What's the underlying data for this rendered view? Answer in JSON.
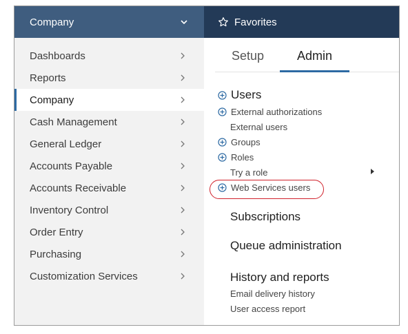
{
  "left_header": {
    "title": "Company",
    "icon": "chevron-down-icon"
  },
  "right_header": {
    "title": "Favorites",
    "icon": "star-outline-icon"
  },
  "nav": {
    "items": [
      {
        "label": "Dashboards"
      },
      {
        "label": "Reports"
      },
      {
        "label": "Company",
        "active": true
      },
      {
        "label": "Cash Management"
      },
      {
        "label": "General Ledger"
      },
      {
        "label": "Accounts Payable"
      },
      {
        "label": "Accounts Receivable"
      },
      {
        "label": "Inventory Control"
      },
      {
        "label": "Order Entry"
      },
      {
        "label": "Purchasing"
      },
      {
        "label": "Customization Services"
      }
    ]
  },
  "tabs": {
    "setup": "Setup",
    "admin": "Admin",
    "active": "Admin"
  },
  "admin": {
    "users_heading": "Users",
    "external_authorizations": "External authorizations",
    "external_users": "External users",
    "groups": "Groups",
    "roles": "Roles",
    "try_a_role": "Try a role",
    "web_services_users": "Web Services users",
    "subscriptions": "Subscriptions",
    "queue_administration": "Queue administration",
    "history_heading": "History and reports",
    "email_delivery_history": "Email delivery history",
    "user_access_report": "User access report"
  },
  "colors": {
    "left_header_bg": "#3f5d7f",
    "right_header_bg": "#233a57",
    "accent": "#2d6aa3",
    "highlight": "#d0202a"
  }
}
